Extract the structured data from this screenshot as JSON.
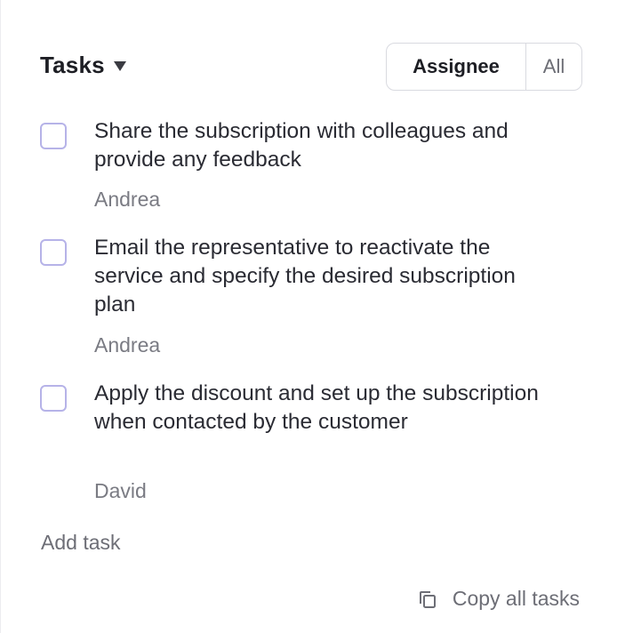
{
  "header": {
    "title": "Tasks",
    "filter": {
      "options": [
        "Assignee",
        "All"
      ],
      "selected": "Assignee"
    }
  },
  "tasks": [
    {
      "text": "Share the subscription with colleagues and provide any feedback",
      "assignee": "Andrea",
      "completed": false
    },
    {
      "text": "Email the representative to reactivate the service and specify the desired subscription plan",
      "assignee": "Andrea",
      "completed": false
    },
    {
      "text": "Apply the discount and set up the subscription when contacted by the customer",
      "assignee": "David",
      "completed": false
    }
  ],
  "footer": {
    "add_task_label": "Add task",
    "copy_all_label": "Copy all tasks",
    "copy_icon": "copy-icon"
  },
  "colors": {
    "checkbox_border": "#b6b3e8",
    "text": "#2a2b33",
    "muted": "#7a7b83"
  }
}
